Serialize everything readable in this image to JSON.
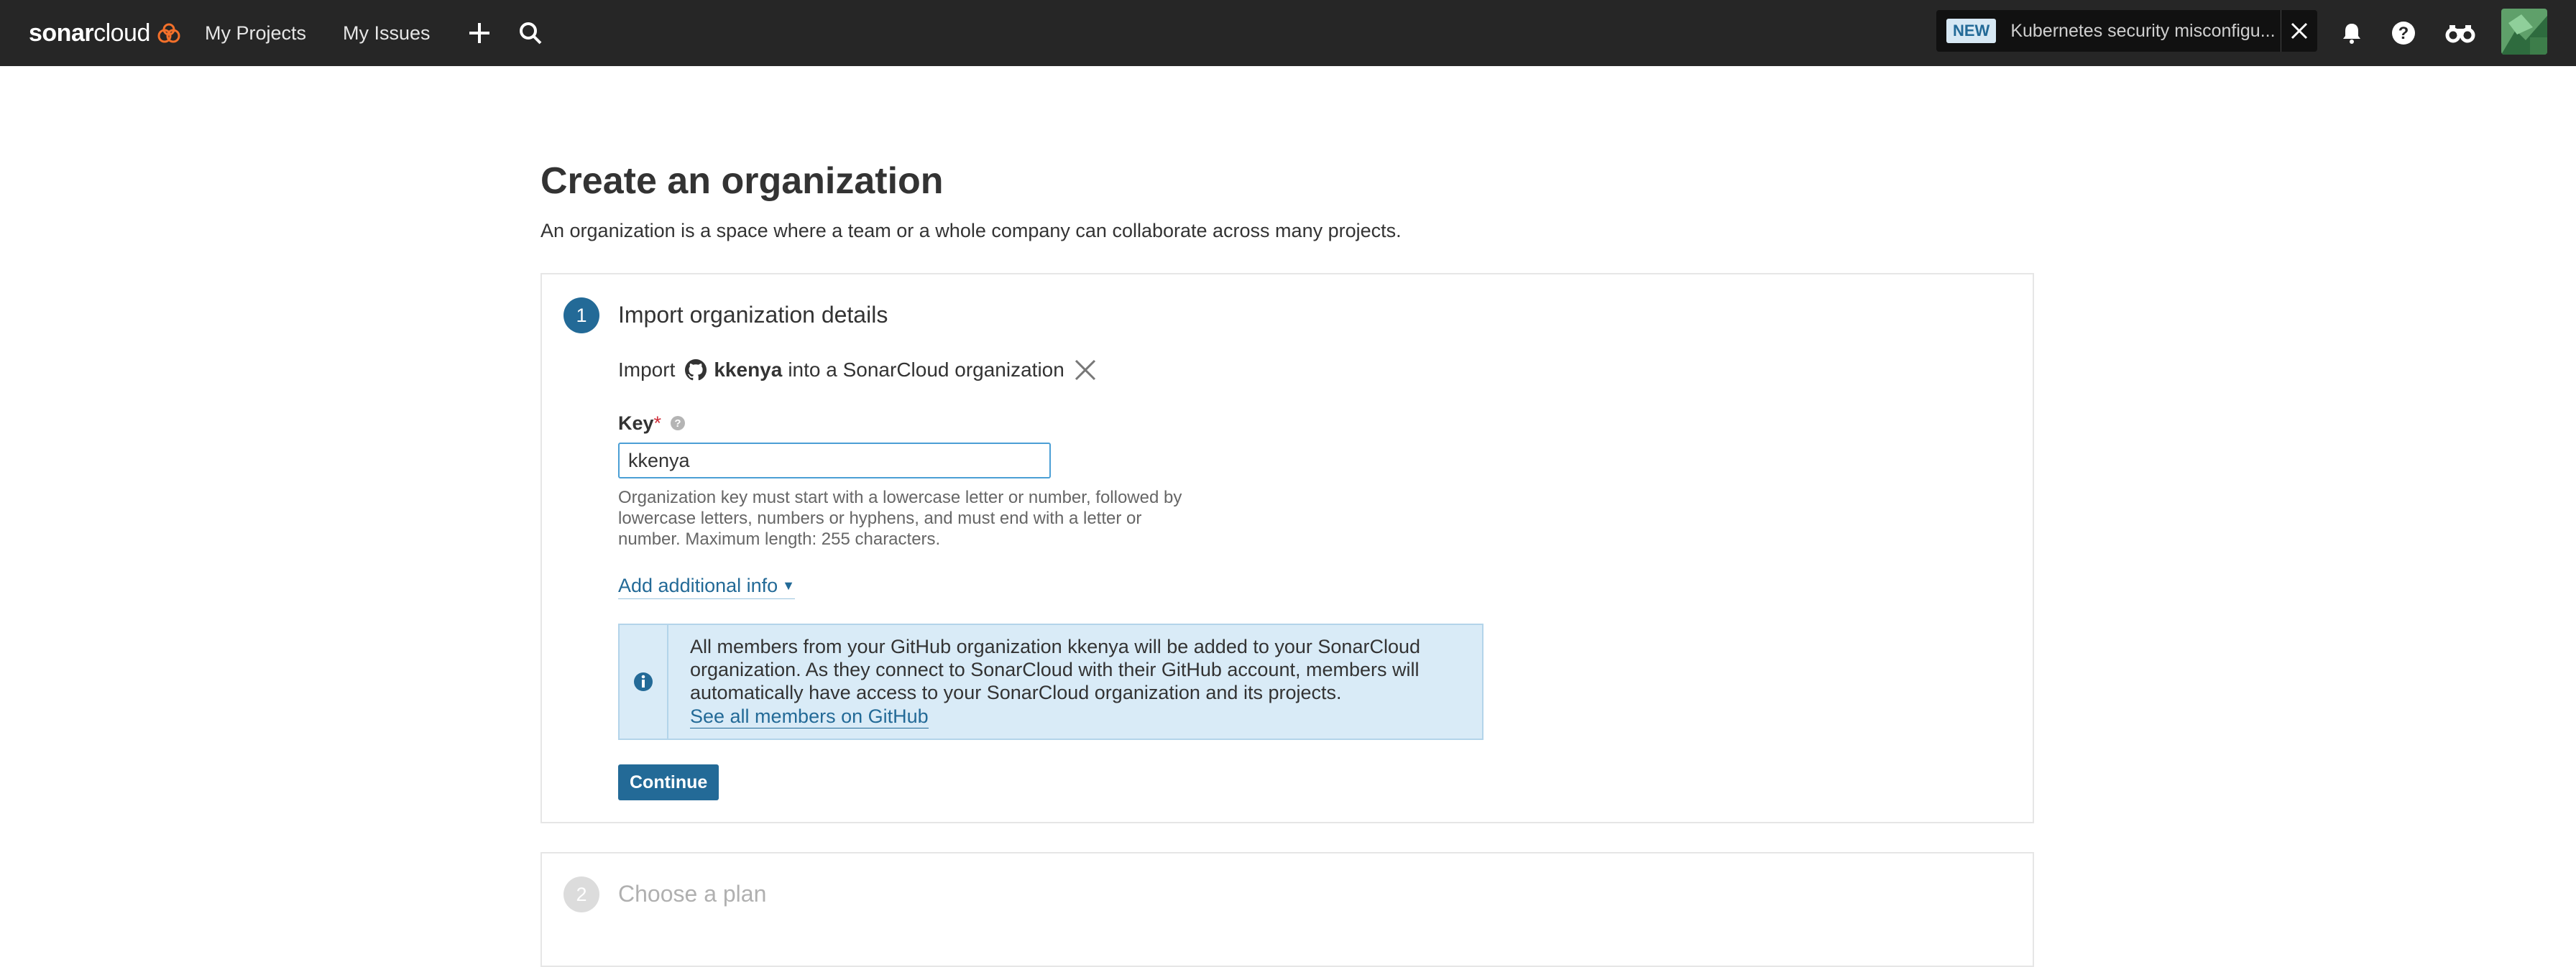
{
  "navbar": {
    "logo_part1": "sonar",
    "logo_part2": "cloud",
    "links": [
      "My Projects",
      "My Issues"
    ],
    "promo_badge": "NEW",
    "promo_text": "Kubernetes security misconfigu..."
  },
  "page": {
    "title": "Create an organization",
    "description": "An organization is a space where a team or a whole company can collaborate across many projects."
  },
  "step1": {
    "number": "1",
    "title": "Import organization details",
    "import_prefix": "Import",
    "org_name": "kkenya",
    "import_suffix": "into a SonarCloud organization",
    "key_label": "Key",
    "key_required_mark": "*",
    "key_value": "kkenya",
    "key_hint": "Organization key must start with a lowercase letter or number, followed by lowercase letters, numbers or hyphens, and must end with a letter or number. Maximum length: 255 characters.",
    "add_info_link": "Add additional info",
    "info_message": "All members from your GitHub organization kkenya will be added to your SonarCloud organization. As they connect to SonarCloud with their GitHub account, members will automatically have access to your SonarCloud organization and its projects.",
    "info_link": "See all members on GitHub",
    "continue_label": "Continue"
  },
  "step2": {
    "number": "2",
    "title": "Choose a plan"
  },
  "colors": {
    "navbar_bg": "#262626",
    "accent": "#236a97",
    "info_bg": "#d9ebf7",
    "required": "#d02f3a"
  },
  "icons": [
    "sonarcloud-logo-icon",
    "plus-icon",
    "search-icon",
    "close-icon",
    "bell-icon",
    "help-icon",
    "binoculars-icon",
    "github-icon",
    "info-icon"
  ]
}
